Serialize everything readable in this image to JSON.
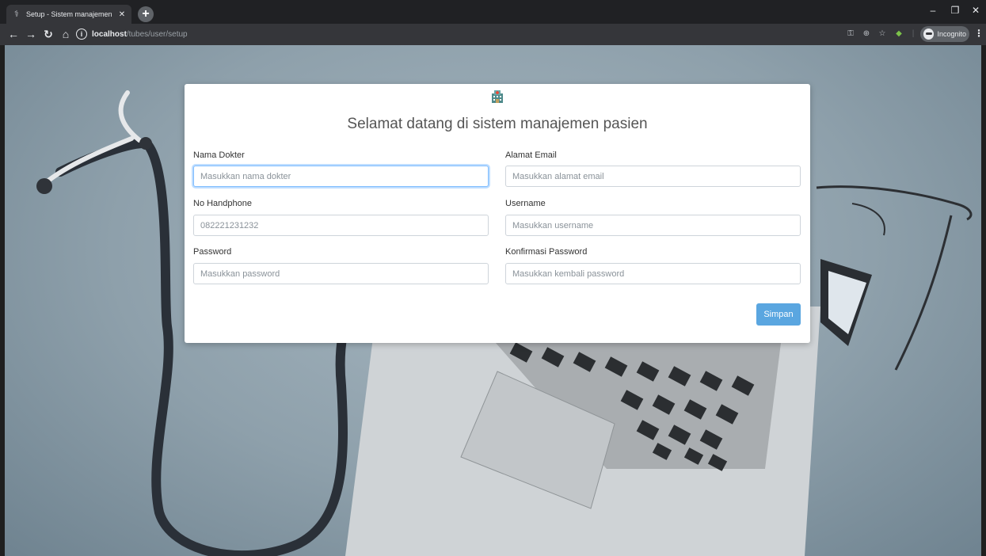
{
  "browser": {
    "tab_title": "Setup - Sistem manajemen pasie",
    "url_host": "localhost",
    "url_path": "/tubes/user/setup",
    "incognito_label": "Incognito"
  },
  "form": {
    "title": "Selamat datang di sistem manajemen pasien",
    "fields": [
      {
        "label": "Nama Dokter",
        "placeholder": "Masukkan nama dokter",
        "value": ""
      },
      {
        "label": "Alamat Email",
        "placeholder": "Masukkan alamat email",
        "value": ""
      },
      {
        "label": "No Handphone",
        "placeholder": "082221231232",
        "value": ""
      },
      {
        "label": "Username",
        "placeholder": "Masukkan username",
        "value": ""
      },
      {
        "label": "Password",
        "placeholder": "Masukkan password",
        "value": ""
      },
      {
        "label": "Konfirmasi Password",
        "placeholder": "Masukkan kembali password",
        "value": ""
      }
    ],
    "submit_label": "Simpan"
  },
  "colors": {
    "primary_button": "#5aa6e0",
    "focus_border": "#80bdff",
    "chrome_dark": "#202124",
    "chrome_toolbar": "#35363a"
  },
  "icons": {
    "tab_favicon": "stethoscope-icon",
    "card_icon": "hospital-icon"
  }
}
